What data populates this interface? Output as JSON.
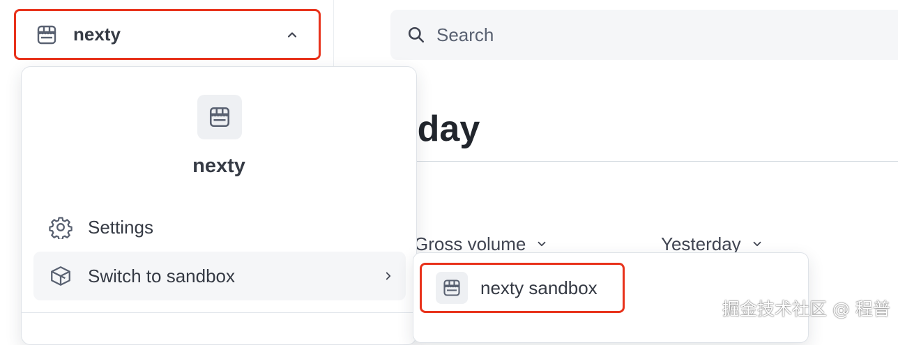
{
  "header": {
    "account_name": "nexty",
    "search_placeholder": "Search"
  },
  "page": {
    "title": "Today",
    "filters": [
      {
        "label": "Gross volume"
      },
      {
        "label": "Yesterday"
      }
    ]
  },
  "account_menu": {
    "account_name": "nexty",
    "items": [
      {
        "label": "Settings",
        "icon": "gear-icon"
      },
      {
        "label": "Switch to sandbox",
        "icon": "sandbox-cube-icon",
        "has_submenu": true
      }
    ]
  },
  "sandbox_submenu": {
    "items": [
      {
        "label": "nexty sandbox",
        "icon": "store-icon"
      }
    ]
  },
  "watermark": "掘金技术社区 @ 程普",
  "colors": {
    "highlight": "#e8321b",
    "text": "#353a44",
    "muted": "#596171",
    "surface": "#f5f6f8"
  }
}
